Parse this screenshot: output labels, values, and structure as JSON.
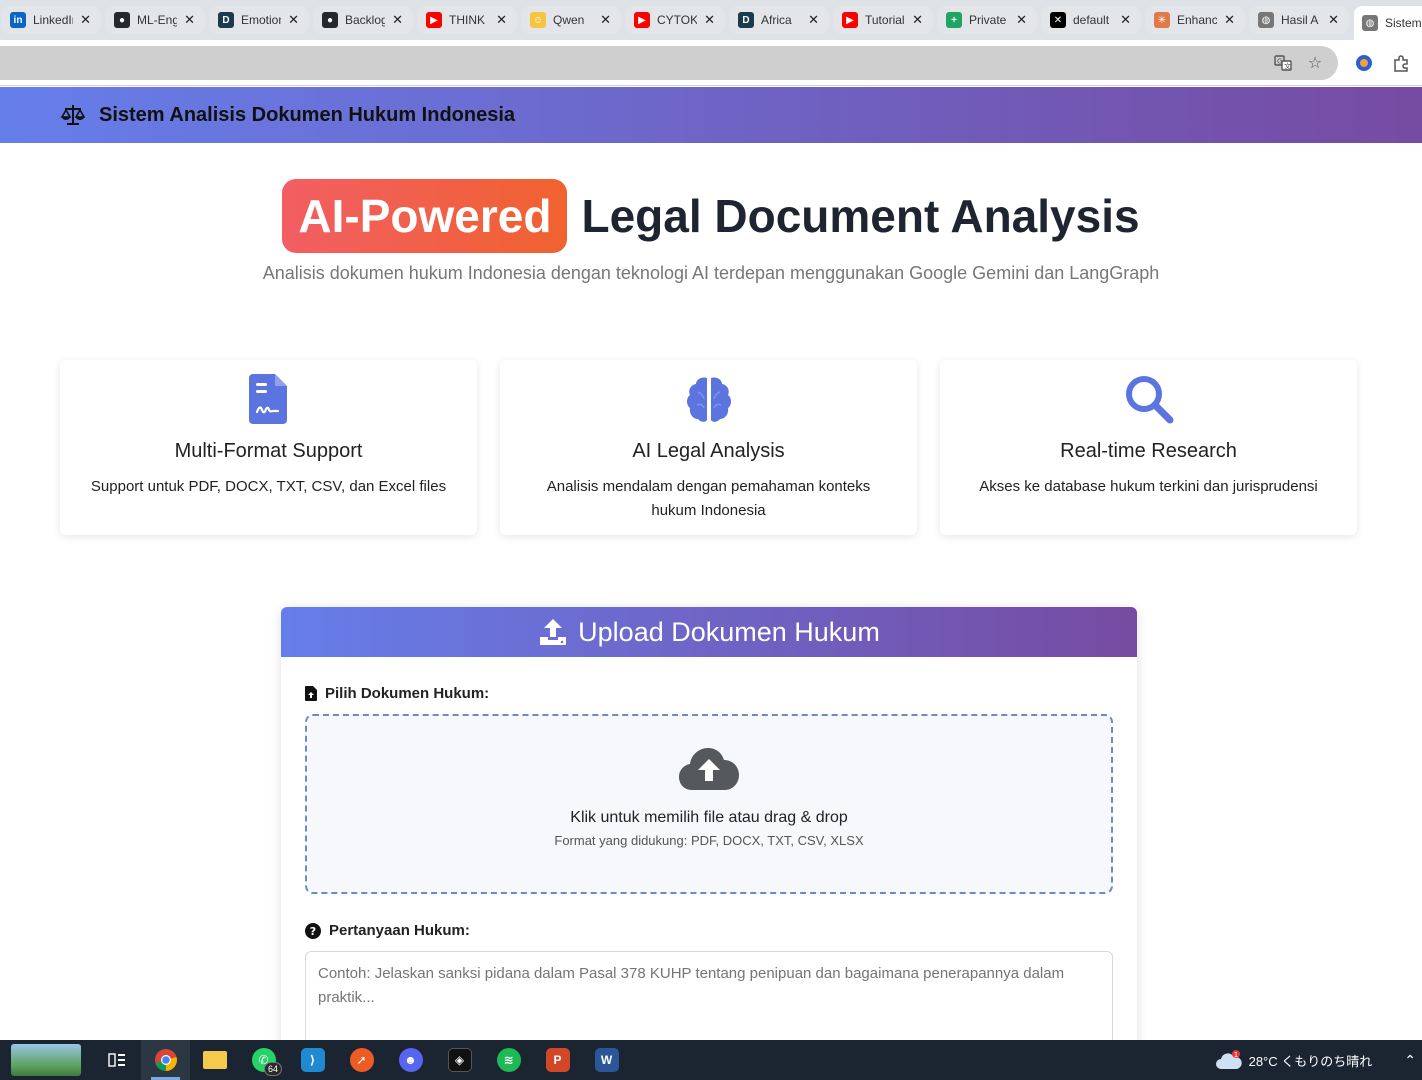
{
  "browser": {
    "tabs": [
      {
        "label": "LinkedIn",
        "icon": "linkedin-icon",
        "color": "#0a66c2",
        "glyph": "in"
      },
      {
        "label": "ML-Eng",
        "icon": "github-icon",
        "color": "#24292e",
        "glyph": "●"
      },
      {
        "label": "Emotion",
        "icon": "d-icon",
        "color": "#1a3b4d",
        "glyph": "D"
      },
      {
        "label": "Backlog",
        "icon": "github-icon",
        "color": "#24292e",
        "glyph": "●"
      },
      {
        "label": "THINK",
        "icon": "youtube-icon",
        "color": "#ff0000",
        "glyph": "▶"
      },
      {
        "label": "Qwen",
        "icon": "qwen-icon",
        "color": "#f5c542",
        "glyph": "☺"
      },
      {
        "label": "CYTOK",
        "icon": "youtube-icon",
        "color": "#ff0000",
        "glyph": "▶"
      },
      {
        "label": "Africa",
        "icon": "d-icon",
        "color": "#1a3b4d",
        "glyph": "D"
      },
      {
        "label": "Tutorial",
        "icon": "youtube-icon",
        "color": "#ff0000",
        "glyph": "▶"
      },
      {
        "label": "Private",
        "icon": "sheets-plus-icon",
        "color": "#1fa463",
        "glyph": "+"
      },
      {
        "label": "default",
        "icon": "x-logo-icon",
        "color": "#000000",
        "glyph": "✕"
      },
      {
        "label": "Enhance",
        "icon": "sparkle-icon",
        "color": "#e07a4a",
        "glyph": "✳"
      },
      {
        "label": "Hasil A",
        "icon": "globe-icon",
        "color": "#777777",
        "glyph": "◍"
      },
      {
        "label": "Sistem",
        "icon": "globe-icon",
        "color": "#777777",
        "glyph": "◍",
        "active": true
      }
    ]
  },
  "navbar": {
    "brand": "Sistem Analisis Dokumen Hukum Indonesia"
  },
  "hero": {
    "highlight": "AI-Powered",
    "title_rest": "Legal Document Analysis",
    "subtitle": "Analisis dokumen hukum Indonesia dengan teknologi AI terdepan menggunakan Google Gemini dan LangGraph"
  },
  "features": [
    {
      "title": "Multi-Format Support",
      "desc": "Support untuk PDF, DOCX, TXT, CSV, dan Excel files",
      "icon": "file-contract-icon"
    },
    {
      "title": "AI Legal Analysis",
      "desc": "Analisis mendalam dengan pemahaman konteks hukum Indonesia",
      "icon": "brain-icon"
    },
    {
      "title": "Real-time Research",
      "desc": "Akses ke database hukum terkini dan jurisprudensi",
      "icon": "search-icon"
    }
  ],
  "upload": {
    "header": "Upload Dokumen Hukum",
    "file_label": "Pilih Dokumen Hukum:",
    "drop_text": "Klik untuk memilih file atau drag & drop",
    "formats": "Format yang didukung: PDF, DOCX, TXT, CSV, XLSX",
    "question_label": "Pertanyaan Hukum:",
    "question_placeholder": "Contoh: Jelaskan sanksi pidana dalam Pasal 378 KUHP tentang penipuan dan bagaimana penerapannya dalam praktik..."
  },
  "taskbar": {
    "whatsapp_badge": "64",
    "weather": "28°C  くもりのち晴れ"
  },
  "colors": {
    "gradient_start": "#667eea",
    "gradient_end": "#764ba2",
    "highlight_start": "#f25e63",
    "highlight_end": "#f0622f",
    "feature_icon": "#5b74e0"
  }
}
